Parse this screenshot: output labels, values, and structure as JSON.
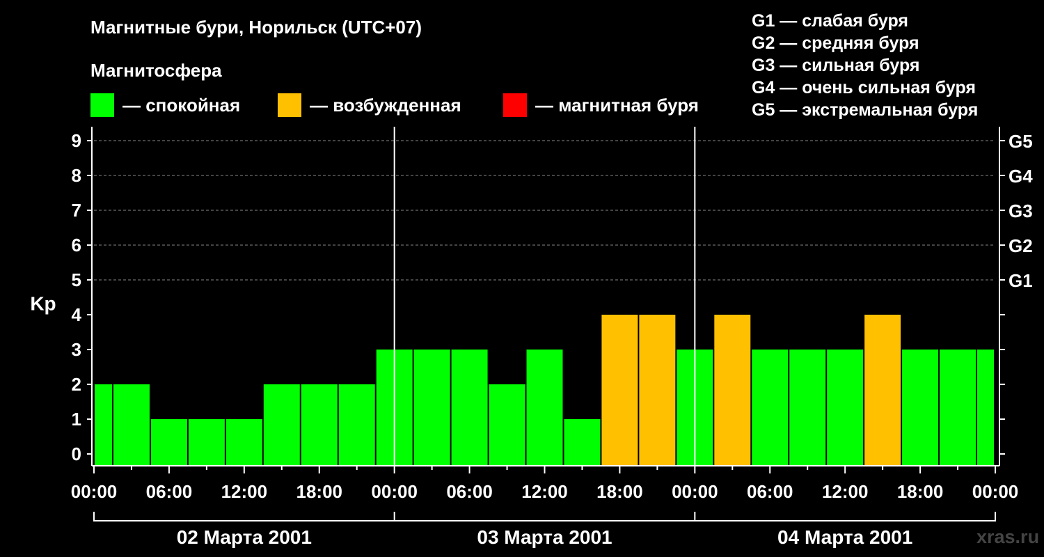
{
  "title": "Магнитные бури, Норильск (UTC+07)",
  "legend": {
    "title": "Магнитосфера",
    "items": [
      {
        "label": "— спокойная",
        "color": "#00ff00"
      },
      {
        "label": "— возбужденная",
        "color": "#ffc000"
      },
      {
        "label": "— магнитная буря",
        "color": "#ff0000"
      }
    ]
  },
  "storm_scale": [
    "G1 — слабая буря",
    "G2 — средняя буря",
    "G3 — сильная буря",
    "G4 — очень сильная буря",
    "G5 — экстремальная буря"
  ],
  "watermark": "xras.ru",
  "chart_data": {
    "type": "bar",
    "ylabel": "Kp",
    "ylim": [
      0,
      9
    ],
    "y_ticks": [
      0,
      1,
      2,
      3,
      4,
      5,
      6,
      7,
      8,
      9
    ],
    "right_ticks": [
      {
        "value": 5,
        "label": "G1"
      },
      {
        "value": 6,
        "label": "G2"
      },
      {
        "value": 7,
        "label": "G3"
      },
      {
        "value": 8,
        "label": "G4"
      },
      {
        "value": 9,
        "label": "G5"
      }
    ],
    "grid": "dashed horizontal at Kp 5–9",
    "x_ticks": [
      "00:00",
      "06:00",
      "12:00",
      "18:00",
      "00:00",
      "06:00",
      "12:00",
      "18:00",
      "00:00",
      "06:00",
      "12:00",
      "18:00",
      "00:00"
    ],
    "days": [
      "02 Марта 2001",
      "03 Марта 2001",
      "04 Марта 2001"
    ],
    "x": [
      "02 00:00",
      "02 03:00",
      "02 06:00",
      "02 09:00",
      "02 12:00",
      "02 15:00",
      "02 18:00",
      "02 21:00",
      "03 00:00",
      "03 03:00",
      "03 06:00",
      "03 09:00",
      "03 12:00",
      "03 15:00",
      "03 18:00",
      "03 21:00",
      "04 00:00",
      "04 03:00",
      "04 06:00",
      "04 09:00",
      "04 12:00",
      "04 15:00",
      "04 18:00",
      "04 21:00",
      "05 00:00"
    ],
    "values": [
      2,
      2,
      1,
      1,
      1,
      2,
      2,
      2,
      3,
      3,
      3,
      2,
      3,
      1,
      4,
      4,
      3,
      4,
      3,
      3,
      3,
      4,
      3,
      3,
      3
    ],
    "colors": {
      "quiet": "#00ff00",
      "active": "#ffc000",
      "storm": "#ff0000"
    }
  }
}
